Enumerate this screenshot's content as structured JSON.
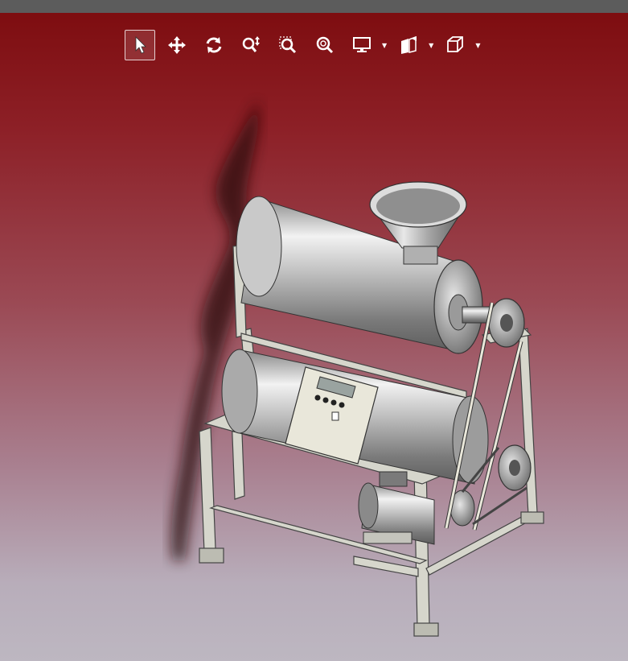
{
  "window": {
    "title": ""
  },
  "viewport": {
    "background_top": "#7e0d10",
    "background_bottom": "#bdb7c1"
  },
  "toolbar": {
    "tools": [
      {
        "id": "select",
        "icon": "cursor-arrow-icon",
        "active": true
      },
      {
        "id": "pan",
        "icon": "move-arrows-icon",
        "active": false
      },
      {
        "id": "rotate",
        "icon": "rotate-icon",
        "active": false
      },
      {
        "id": "zoom",
        "icon": "zoom-updown-icon",
        "active": false
      },
      {
        "id": "zoom-window",
        "icon": "zoom-window-icon",
        "active": false
      },
      {
        "id": "zoom-fit",
        "icon": "zoom-fit-icon",
        "active": false
      },
      {
        "id": "display",
        "icon": "monitor-icon",
        "active": false,
        "dropdown": true
      },
      {
        "id": "section",
        "icon": "section-planes-icon",
        "active": false,
        "dropdown": true
      },
      {
        "id": "view-cube",
        "icon": "view-cube-icon",
        "active": false,
        "dropdown": true
      }
    ]
  },
  "model": {
    "name_visible": false,
    "panel_color": "#e9e7da",
    "frame_color": "#d6d6cc",
    "steel_color": "#c8c8c8"
  }
}
